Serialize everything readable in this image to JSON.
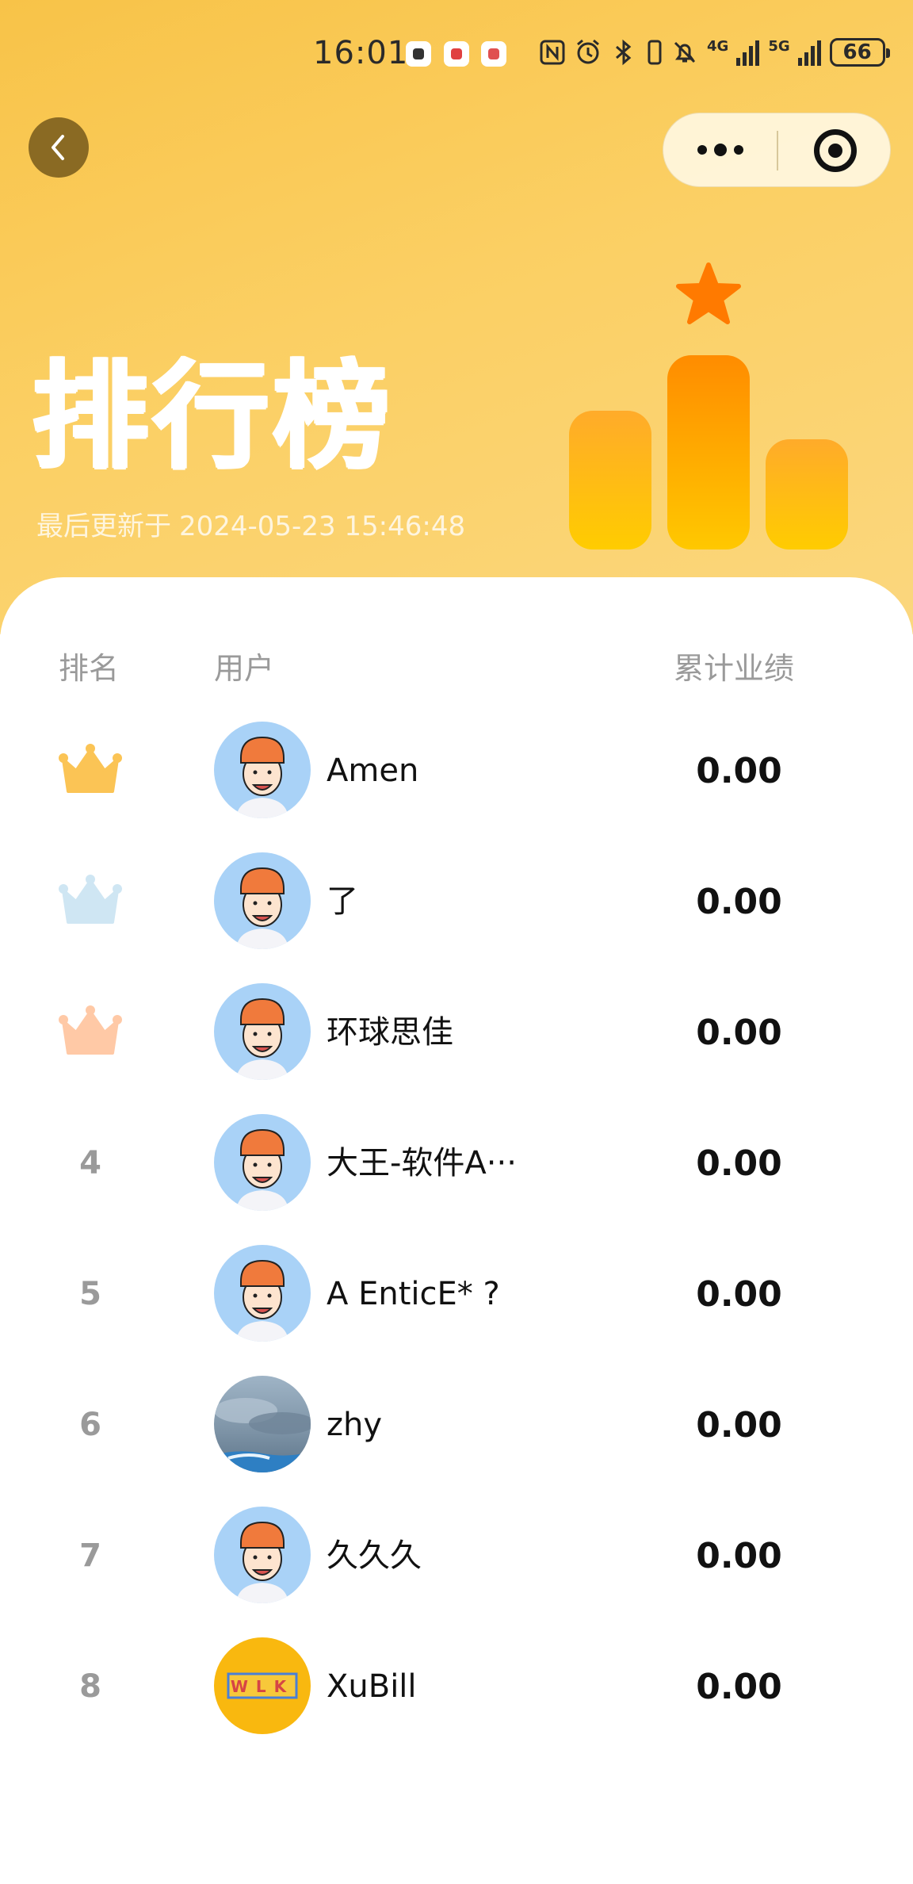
{
  "status_bar": {
    "time": "16:01",
    "battery": "66",
    "network_4g": "4G",
    "network_5g": "5G"
  },
  "header": {
    "title": "排行榜",
    "update_label": "最后更新于",
    "update_time": "2024-05-23 15:46:48"
  },
  "table": {
    "col_rank": "排名",
    "col_user": "用户",
    "col_score": "累计业绩",
    "rows": [
      {
        "rank": "1",
        "name": "Amen",
        "score": "0.00",
        "crown": "gold"
      },
      {
        "rank": "2",
        "name": "了",
        "score": "0.00",
        "crown": "silver"
      },
      {
        "rank": "3",
        "name": "环球思佳",
        "score": "0.00",
        "crown": "bronze"
      },
      {
        "rank": "4",
        "name": "大王-软件A···",
        "score": "0.00"
      },
      {
        "rank": "5",
        "name": "A EnticE* ?",
        "score": "0.00"
      },
      {
        "rank": "6",
        "name": "zhy",
        "score": "0.00"
      },
      {
        "rank": "7",
        "name": "久久久",
        "score": "0.00"
      },
      {
        "rank": "8",
        "name": "XuBill",
        "score": "0.00"
      }
    ]
  },
  "colors": {
    "hero_start": "#f8c348",
    "hero_end": "#fbd77e",
    "crown_gold": "#fbc455",
    "crown_silver": "#cfe6f3",
    "crown_bronze": "#ffc9a6",
    "star": "#ff7a00"
  },
  "avatar_badge_text": "WLK"
}
